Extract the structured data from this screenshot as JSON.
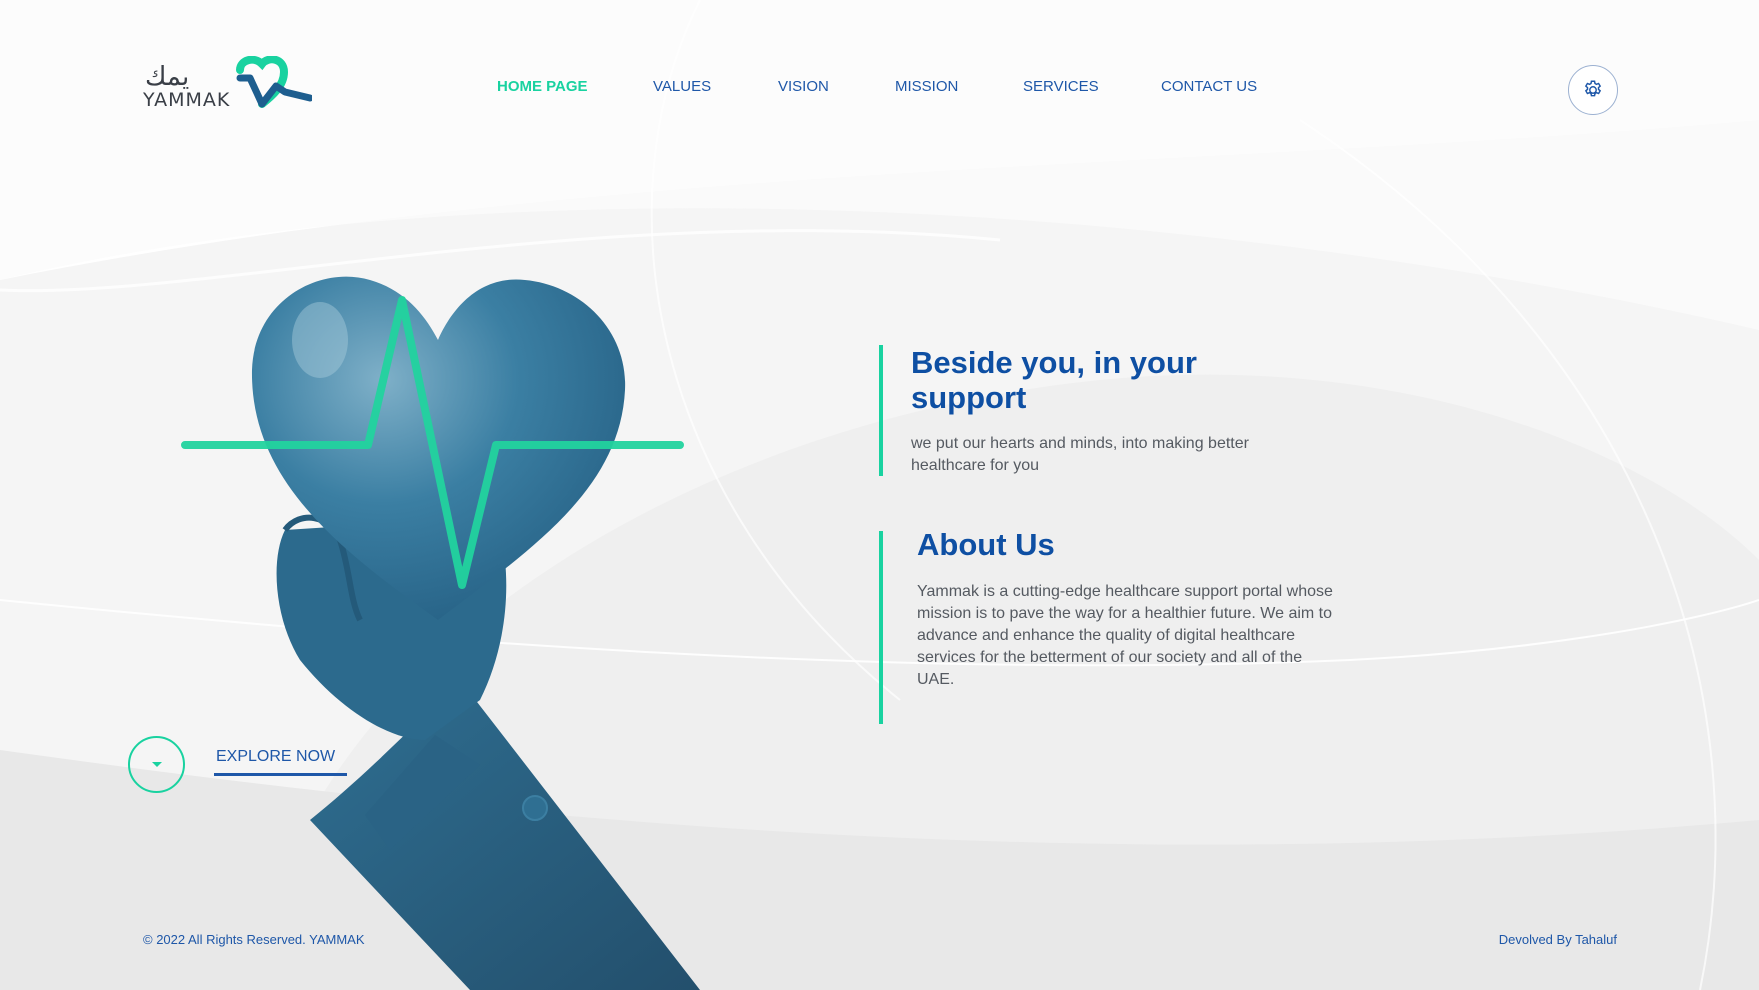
{
  "brand": {
    "logo_arabic": "يمك",
    "logo_word": "YAMMAK",
    "colors": {
      "primary": "#0e4fa3",
      "accent": "#19d2a0",
      "heart": "#2f6f92"
    }
  },
  "nav": {
    "items": [
      {
        "label": "HOME PAGE",
        "active": true
      },
      {
        "label": "VALUES",
        "active": false
      },
      {
        "label": "VISION",
        "active": false
      },
      {
        "label": "MISSION",
        "active": false
      },
      {
        "label": "SERVICES",
        "active": false
      },
      {
        "label": "CONTACT US",
        "active": false
      }
    ],
    "settings_icon": "gear-icon"
  },
  "hero": {
    "title": "Beside you, in your support",
    "subtitle": "we put our hearts and minds, into making better healthcare for you",
    "image": "hand-holding-heart-with-heartbeat"
  },
  "about": {
    "title": "About Us",
    "text": "Yammak is a cutting-edge healthcare support portal whose mission is to pave the way for a healthier future. We aim to advance and enhance the quality of digital healthcare services for the betterment of our society and all of the UAE."
  },
  "explore": {
    "label": "EXPLORE NOW",
    "icon": "chevron-down-icon"
  },
  "footer": {
    "copyright": "© 2022 All Rights Reserved. YAMMAK",
    "credit": "Devolved By Tahaluf"
  }
}
